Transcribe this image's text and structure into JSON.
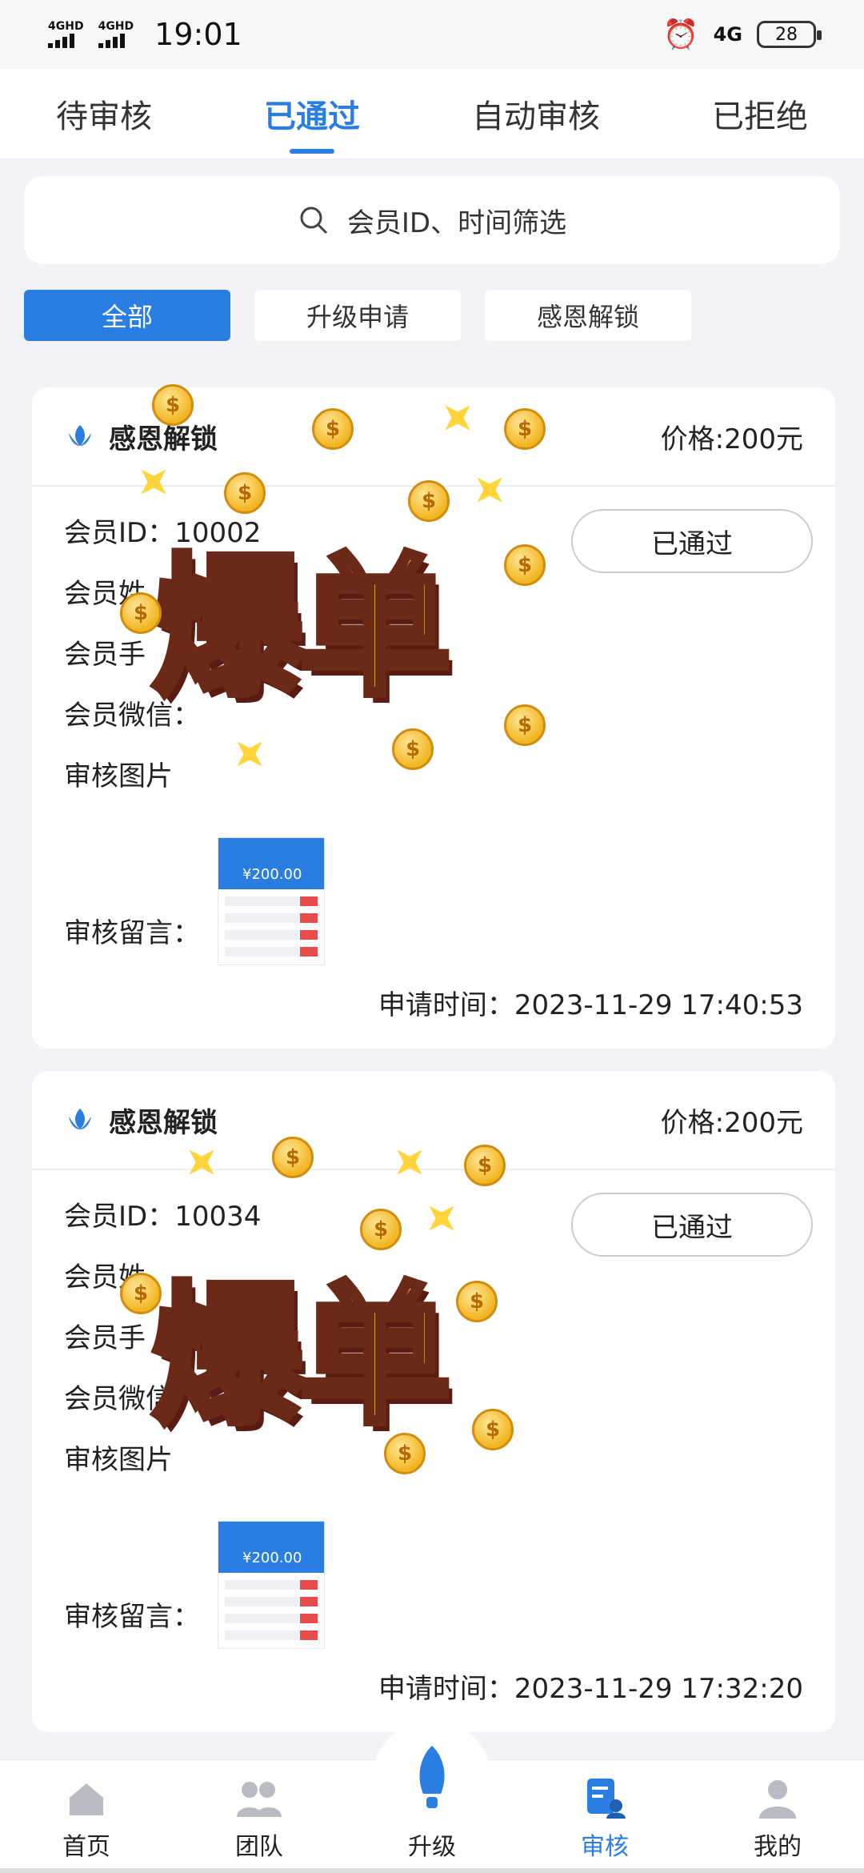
{
  "status_bar": {
    "signal_1": "4GHD",
    "signal_2": "4GHD",
    "time": "19:01",
    "network": "4G",
    "battery": "28"
  },
  "tabs": [
    {
      "label": "待审核"
    },
    {
      "label": "已通过"
    },
    {
      "label": "自动审核"
    },
    {
      "label": "已拒绝"
    }
  ],
  "search": {
    "placeholder": "会员ID、时间筛选"
  },
  "filters": [
    {
      "label": "全部"
    },
    {
      "label": "升级申请"
    },
    {
      "label": "感恩解锁"
    }
  ],
  "records": [
    {
      "type": "感恩解锁",
      "price": "价格:200元",
      "status": "已通过",
      "member_id": "会员ID：10002",
      "member_name": "会员姓",
      "member_phone": "会员手",
      "member_wechat": "会员微信：",
      "review_image_label": "审核图片",
      "thumb_amount": "¥200.00",
      "review_note": "审核留言：",
      "apply_time": "申请时间：2023-11-29 17:40:53"
    },
    {
      "type": "感恩解锁",
      "price": "价格:200元",
      "status": "已通过",
      "member_id": "会员ID：10034",
      "member_name": "会员姓",
      "member_phone": "会员手",
      "member_wechat": "会员微信",
      "review_image_label": "审核图片",
      "thumb_amount": "¥200.00",
      "review_note": "审核留言：",
      "apply_time": "申请时间：2023-11-29 17:32:20"
    }
  ],
  "overlay": {
    "text": "爆单"
  },
  "bottom_nav": [
    {
      "label": "首页",
      "icon": "home-icon"
    },
    {
      "label": "团队",
      "icon": "team-icon"
    },
    {
      "label": "升级",
      "icon": "rocket-icon"
    },
    {
      "label": "审核",
      "icon": "review-icon"
    },
    {
      "label": "我的",
      "icon": "profile-icon"
    }
  ],
  "colors": {
    "accent": "#2a7de1",
    "background": "#f2f3f7"
  }
}
